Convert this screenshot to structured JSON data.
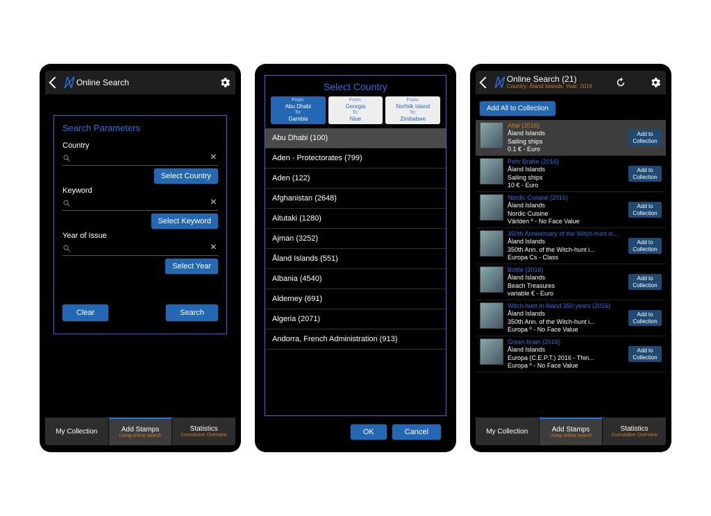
{
  "screen1": {
    "header_title": "Online Search",
    "params_title": "Search Parameters",
    "fields": {
      "country": {
        "label": "Country",
        "button": "Select Country"
      },
      "keyword": {
        "label": "Keyword",
        "button": "Select Keyword"
      },
      "year": {
        "label": "Year of Issue",
        "button": "Select Year"
      }
    },
    "clear_btn": "Clear",
    "search_btn": "Search"
  },
  "bottomnav": {
    "my_collection": "My Collection",
    "add_stamps": "Add Stamps",
    "add_stamps_sub": "Using online search",
    "statistics": "Statistics",
    "statistics_sub": "Cumulative Overview"
  },
  "screen2": {
    "title": "Select Country",
    "ranges": [
      {
        "from_label": "From:",
        "from": "Abu Dhabi",
        "to_label": "To:",
        "to": "Gambia",
        "style": "blue"
      },
      {
        "from_label": "From:",
        "from": "Georgia",
        "to_label": "To:",
        "to": "Niue",
        "style": "white"
      },
      {
        "from_label": "From:",
        "from": "Norfolk Island",
        "to_label": "To:",
        "to": "Zimbabwe",
        "style": "white"
      }
    ],
    "countries": [
      "Abu Dhabi (100)",
      "Aden - Protectorates (799)",
      "Aden (122)",
      "Afghanistan (2648)",
      "Aitutaki (1280)",
      "Ajman (3252)",
      "Åland Islands (551)",
      "Albania (4540)",
      "Alderney (691)",
      "Algeria (2071)",
      "Andorra, French Administration (913)"
    ],
    "ok": "OK",
    "cancel": "Cancel"
  },
  "screen3": {
    "header_title": "Online Search (21)",
    "header_sub": "Country: Åland Islands; Year: 2016",
    "add_all": "Add All to Collection",
    "add_btn_l1": "Add to",
    "add_btn_l2": "Collection",
    "results": [
      {
        "title": "Altai (2016)",
        "title_orange": true,
        "l1": "Åland Islands",
        "l2": "Sailing ships",
        "l3": "0.1 € - Euro",
        "sel": true
      },
      {
        "title": "Pehr Brahe (2016)",
        "l1": "Åland Islands",
        "l2": "Sailing ships",
        "l3": "10 € - Euro"
      },
      {
        "title": "Nordic Cuisine (2016)",
        "l1": "Åland Islands",
        "l2": "Nordic Cuisine",
        "l3": "Världen º - No Face Value"
      },
      {
        "title": "350th Anniversary of the Witch-hunt in...",
        "l1": "Åland Islands",
        "l2": "350th Ann. of the Witch-hunt i...",
        "l3": "Europa Cs - Class"
      },
      {
        "title": "Bottle (2016)",
        "l1": "Åland Islands",
        "l2": "Beach Treasures",
        "l3": "variable € - Euro"
      },
      {
        "title": "Witch-hunt in Aland 350 years (2016)",
        "l1": "Åland Islands",
        "l2": "350th Ann. of the Witch-hunt i...",
        "l3": "Europa º - No Face Value"
      },
      {
        "title": "Green brain (2016)",
        "l1": "Åland Islands",
        "l2": "Europa (C.E.P.T.) 2016 - Thin...",
        "l3": "Europa º - No Face Value"
      }
    ]
  }
}
